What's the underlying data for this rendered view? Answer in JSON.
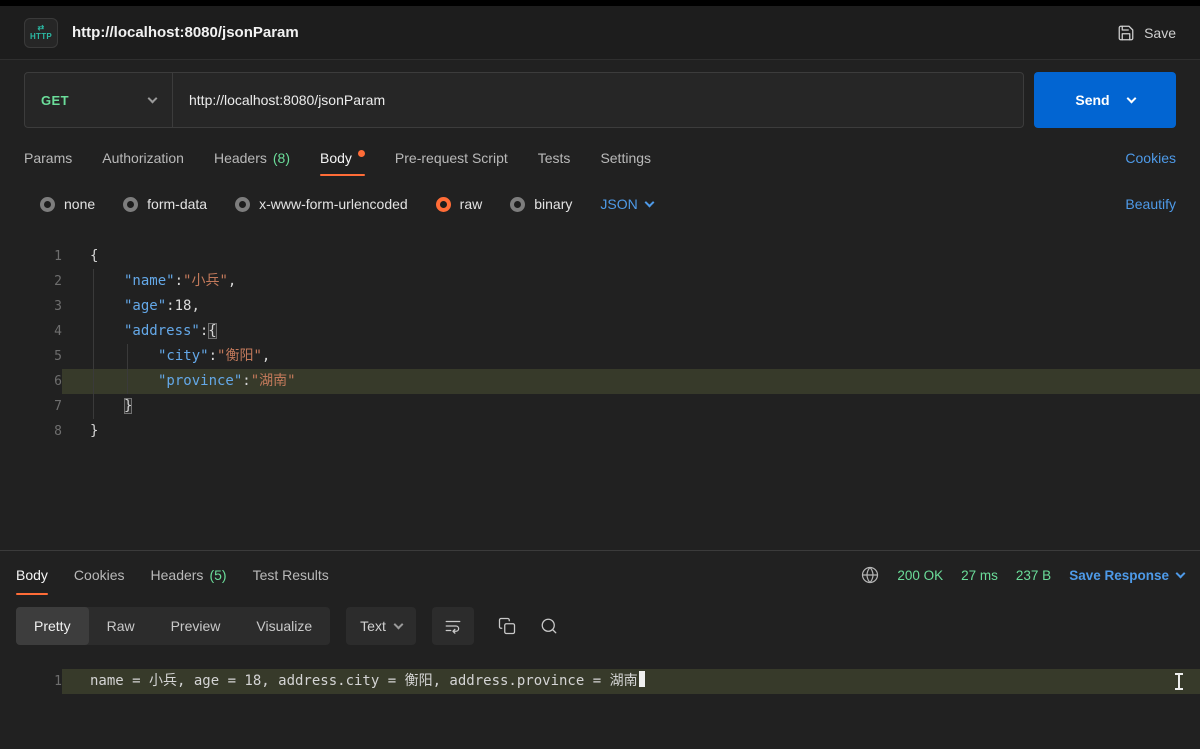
{
  "header": {
    "http_badge": "HTTP",
    "http_badge_arrows": "⇄",
    "title": "http://localhost:8080/jsonParam",
    "save": "Save"
  },
  "request": {
    "method": "GET",
    "url": "http://localhost:8080/jsonParam",
    "send": "Send"
  },
  "tabs": {
    "params": "Params",
    "authorization": "Authorization",
    "headers": "Headers",
    "headers_count": "(8)",
    "body": "Body",
    "prerequest": "Pre-request Script",
    "tests": "Tests",
    "settings": "Settings",
    "cookies": "Cookies"
  },
  "body_options": {
    "none": "none",
    "form_data": "form-data",
    "urlencoded": "x-www-form-urlencoded",
    "raw": "raw",
    "binary": "binary",
    "selected": "raw",
    "format": "JSON",
    "beautify": "Beautify"
  },
  "editor": {
    "gutter": [
      "1",
      "2",
      "3",
      "4",
      "5",
      "6",
      "7",
      "8"
    ],
    "l1": {
      "open": "{"
    },
    "l2": {
      "key": "\"name\"",
      "colon": ":",
      "value": "\"小兵\"",
      "comma": ","
    },
    "l3": {
      "key": "\"age\"",
      "colon": ":",
      "value": "18",
      "comma": ","
    },
    "l4": {
      "key": "\"address\"",
      "colon": ":",
      "open": "{"
    },
    "l5": {
      "key": "\"city\"",
      "colon": ":",
      "value": "\"衡阳\"",
      "comma": ","
    },
    "l6": {
      "key": "\"province\"",
      "colon": ":",
      "value": "\"湖南\""
    },
    "l7": {
      "close": "}"
    },
    "l8": {
      "close": "}"
    }
  },
  "response": {
    "tabs": {
      "body": "Body",
      "cookies": "Cookies",
      "headers": "Headers",
      "headers_count": "(5)",
      "test_results": "Test Results"
    },
    "status": "200 OK",
    "time": "27 ms",
    "size": "237 B",
    "save_response": "Save Response",
    "views": {
      "pretty": "Pretty",
      "raw": "Raw",
      "preview": "Preview",
      "visualize": "Visualize"
    },
    "active_view": "Pretty",
    "format": "Text",
    "body_line_number": "1",
    "body_text": "name = 小兵, age = 18, address.city = 衡阳, address.province = 湖南"
  },
  "colors": {
    "accent_orange": "#ff6c37",
    "success_green": "#6bdd9a",
    "link_blue": "#4e9ae8",
    "send_blue": "#0265d2",
    "key_blue": "#64a8e8",
    "string_orange": "#c2795b",
    "line_highlight": "#373a2a"
  }
}
